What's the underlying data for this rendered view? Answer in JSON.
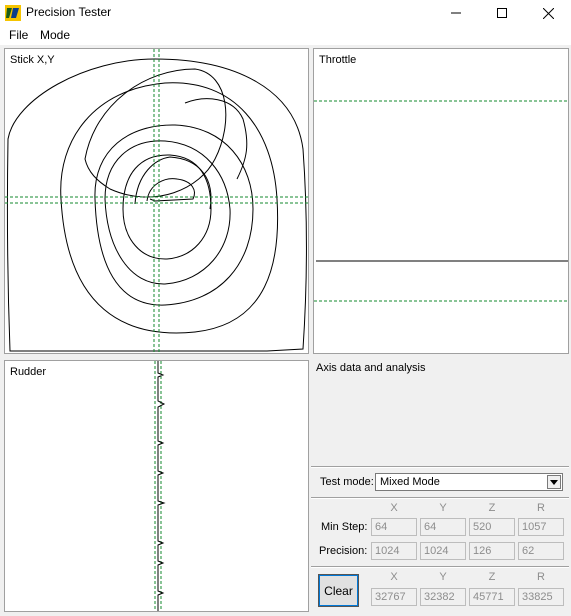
{
  "window": {
    "title": "Precision Tester",
    "icon": "app-logo-icon"
  },
  "menu": {
    "items": [
      "File",
      "Mode"
    ]
  },
  "panels": {
    "stick": "Stick X,Y",
    "throttle": "Throttle",
    "rudder": "Rudder",
    "analysis": "Axis data and analysis"
  },
  "test_mode": {
    "label": "Test mode:",
    "value": "Mixed Mode"
  },
  "columns": [
    "X",
    "Y",
    "Z",
    "R"
  ],
  "min_step": {
    "label": "Min Step:",
    "values": [
      "64",
      "64",
      "520",
      "1057"
    ]
  },
  "precision": {
    "label": "Precision:",
    "values": [
      "1024",
      "1024",
      "126",
      "62"
    ]
  },
  "clear_label": "Clear",
  "raw_values": [
    "32767",
    "32382",
    "45771",
    "33825"
  ],
  "colors": {
    "guide": "#138a2c",
    "trace": "#000000"
  }
}
